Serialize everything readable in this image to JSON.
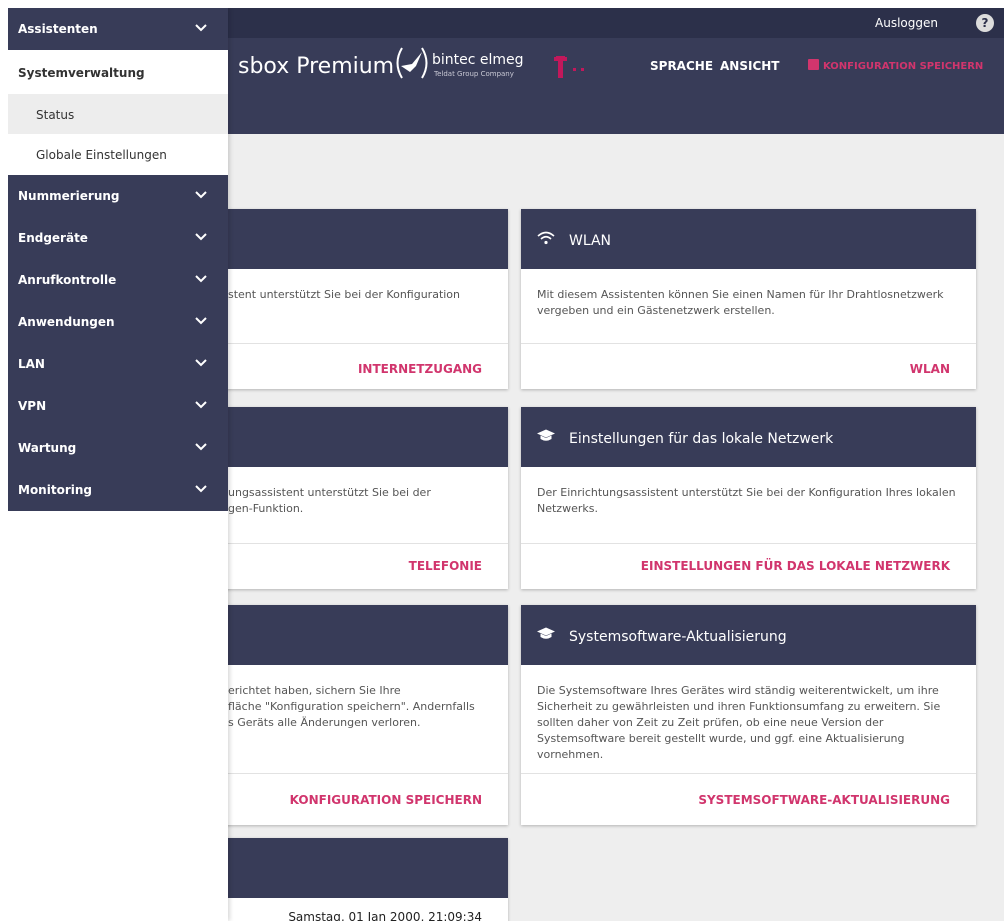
{
  "header": {
    "logout_label": "Ausloggen",
    "help_icon": "?",
    "product_name": "sbox Premium",
    "logo_name": "bintec elmeg",
    "logo_sub": "Teldat Group Company",
    "nav_language": "SPRACHE",
    "nav_view": "ANSICHT",
    "save_config": "KONFIGURATION SPEICHERN"
  },
  "menu": {
    "assistenten": "Assistenten",
    "systemverwaltung": "Systemverwaltung",
    "status": "Status",
    "globale": "Globale Einstellungen",
    "nummerierung": "Nummerierung",
    "endgeraete": "Endgeräte",
    "anrufkontrolle": "Anrufkontrolle",
    "anwendungen": "Anwendungen",
    "lan": "LAN",
    "vpn": "VPN",
    "wartung": "Wartung",
    "monitoring": "Monitoring"
  },
  "cards": {
    "internet": {
      "body": "stent unterstützt Sie bei der Konfiguration",
      "link": "INTERNETZUGANG"
    },
    "wlan": {
      "title": "WLAN",
      "body": "Mit diesem Assistenten können Sie einen Namen für Ihr Drahtlosnetzwerk vergeben und ein Gästenetzwerk erstellen.",
      "link": "WLAN"
    },
    "telefonie": {
      "body_line1": "ungsassistent unterstützt Sie bei der",
      "body_line2": "gen-Funktion.",
      "link": "TELEFONIE"
    },
    "lan": {
      "title": "Einstellungen für das lokale Netzwerk",
      "body": "Der Einrichtungsassistent unterstützt Sie bei der Konfiguration Ihres lokalen Netzwerks.",
      "link": "EINSTELLUNGEN FÜR DAS LOKALE NETZWERK"
    },
    "save": {
      "body_line1": "erichtet haben, sichern Sie Ihre",
      "body_line2": "fläche \"Konfiguration speichern\". Andernfalls",
      "body_line3": "s Geräts alle Änderungen verloren.",
      "link": "KONFIGURATION SPEICHERN"
    },
    "software": {
      "title": "Systemsoftware-Aktualisierung",
      "body": "Die Systemsoftware Ihres Gerätes wird ständig weiterentwickelt, um ihre Sicherheit zu gewährleisten und ihren Funktionsumfang zu erweitern. Sie sollten daher von Zeit zu Zeit prüfen, ob eine neue Version der Systemsoftware bereit gestellt wurde, und ggf. eine Aktualisierung vornehmen.",
      "link": "SYSTEMSOFTWARE-AKTUALISIERUNG"
    },
    "time": {
      "date": "Samstag, 01 Jan 2000, 21:09:34"
    }
  }
}
